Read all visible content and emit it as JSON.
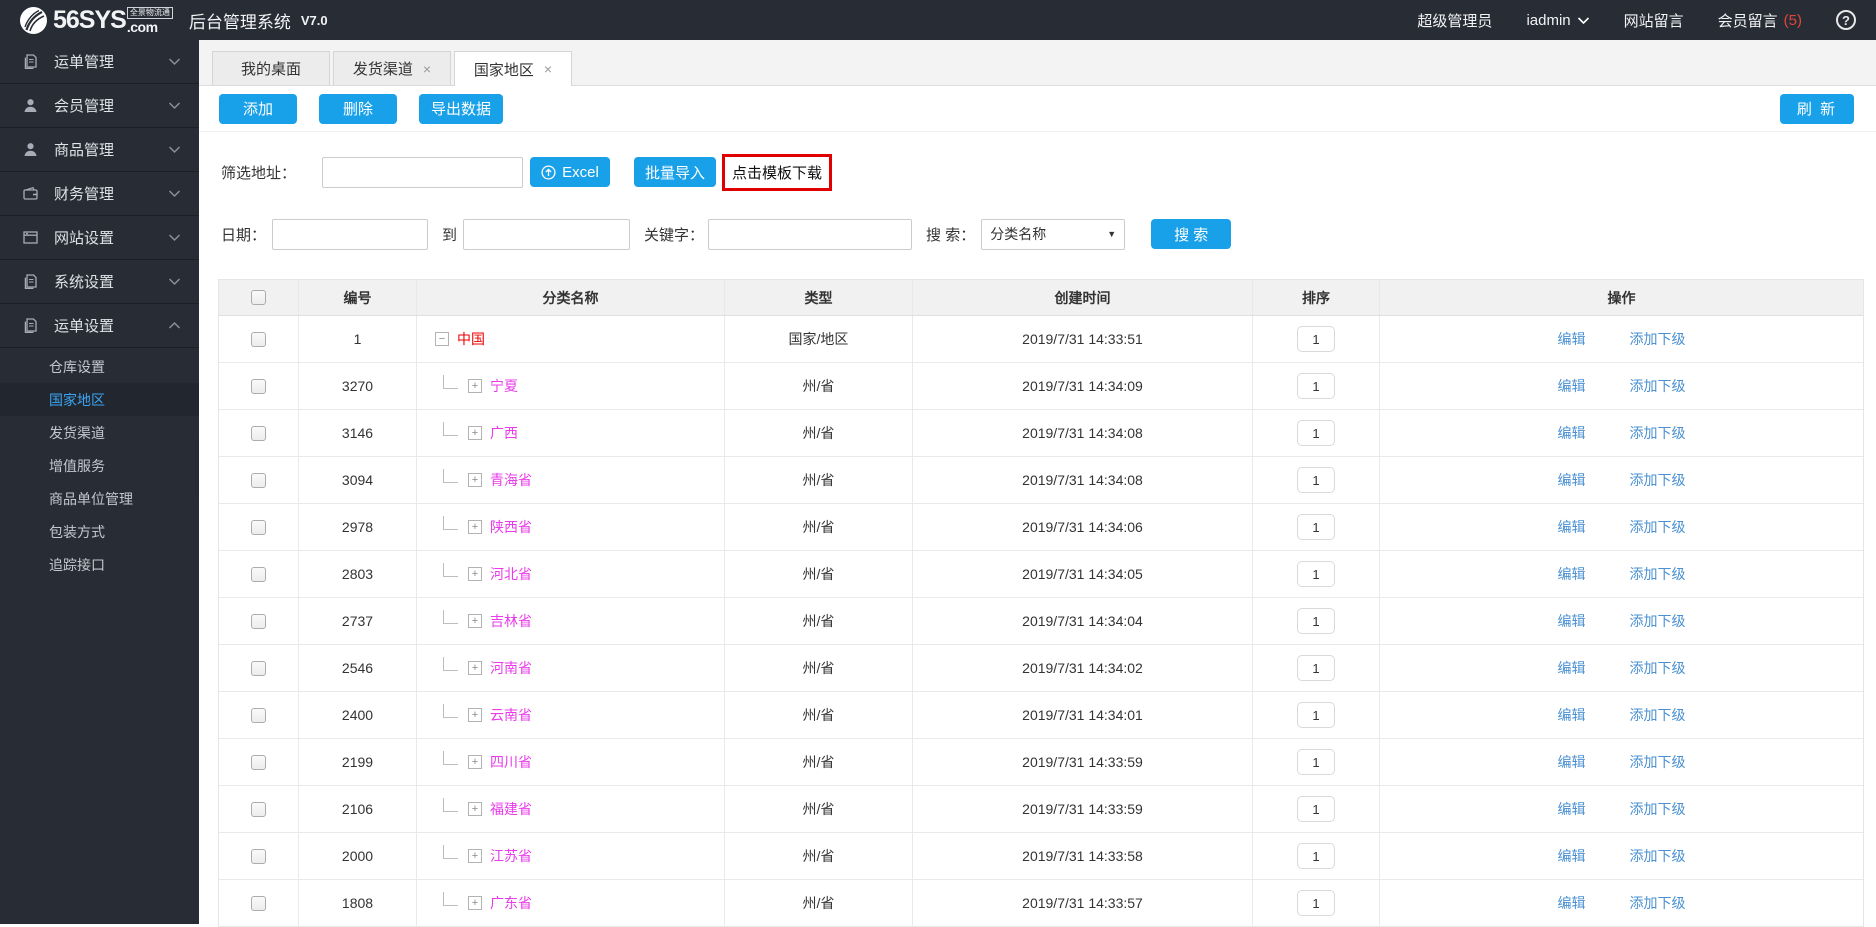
{
  "topbar": {
    "logo_main": "56SYS",
    "logo_small": "全景物流通",
    "logo_com": ".com",
    "app_title": "后台管理系统",
    "version": "V7.0",
    "role": "超级管理员",
    "username": "iadmin",
    "site_messages": "网站留言",
    "member_messages": "会员留言",
    "member_message_count": "(5)",
    "help_glyph": "?"
  },
  "sidebar": {
    "items": [
      {
        "label": "运单管理",
        "icon": "doc-icon",
        "expanded": false
      },
      {
        "label": "会员管理",
        "icon": "user-icon",
        "expanded": false
      },
      {
        "label": "商品管理",
        "icon": "user-icon",
        "expanded": false
      },
      {
        "label": "财务管理",
        "icon": "wallet-icon",
        "expanded": false
      },
      {
        "label": "网站设置",
        "icon": "window-icon",
        "expanded": false
      },
      {
        "label": "系统设置",
        "icon": "doc-icon",
        "expanded": false
      },
      {
        "label": "运单设置",
        "icon": "doc-icon",
        "expanded": true,
        "children": [
          "仓库设置",
          "国家地区",
          "发货渠道",
          "增值服务",
          "商品单位管理",
          "包装方式",
          "追踪接口"
        ],
        "active_child": "国家地区"
      }
    ]
  },
  "tabs": [
    {
      "label": "我的桌面",
      "closable": false,
      "active": false
    },
    {
      "label": "发货渠道",
      "closable": true,
      "active": false
    },
    {
      "label": "国家地区",
      "closable": true,
      "active": true
    }
  ],
  "toolbar": {
    "add": "添加",
    "delete": "删除",
    "export": "导出数据",
    "refresh": "刷 新"
  },
  "filter": {
    "address_label": "筛选地址：",
    "address_value": "",
    "excel_button": "Excel",
    "batch_import": "批量导入",
    "template_download": "点击模板下载",
    "date_label": "日期：",
    "date_from": "",
    "to_label": "到",
    "date_to": "",
    "keyword_label": "关键字：",
    "keyword_value": "",
    "search_label": "搜 索：",
    "search_select": "分类名称",
    "search_button": "搜 索"
  },
  "table": {
    "headers": [
      "编号",
      "分类名称",
      "类型",
      "创建时间",
      "排序",
      "操作"
    ],
    "actions": [
      "编辑",
      "添加下级"
    ],
    "tree_icons": {
      "collapse": "−",
      "expand": "+"
    },
    "rows": [
      {
        "no": "1",
        "name": "中国",
        "root": true,
        "type": "国家/地区",
        "created": "2019/7/31 14:33:51",
        "sort": "1"
      },
      {
        "no": "3270",
        "name": "宁夏",
        "root": false,
        "type": "州/省",
        "created": "2019/7/31 14:34:09",
        "sort": "1"
      },
      {
        "no": "3146",
        "name": "广西",
        "root": false,
        "type": "州/省",
        "created": "2019/7/31 14:34:08",
        "sort": "1"
      },
      {
        "no": "3094",
        "name": "青海省",
        "root": false,
        "type": "州/省",
        "created": "2019/7/31 14:34:08",
        "sort": "1"
      },
      {
        "no": "2978",
        "name": "陕西省",
        "root": false,
        "type": "州/省",
        "created": "2019/7/31 14:34:06",
        "sort": "1"
      },
      {
        "no": "2803",
        "name": "河北省",
        "root": false,
        "type": "州/省",
        "created": "2019/7/31 14:34:05",
        "sort": "1"
      },
      {
        "no": "2737",
        "name": "吉林省",
        "root": false,
        "type": "州/省",
        "created": "2019/7/31 14:34:04",
        "sort": "1"
      },
      {
        "no": "2546",
        "name": "河南省",
        "root": false,
        "type": "州/省",
        "created": "2019/7/31 14:34:02",
        "sort": "1"
      },
      {
        "no": "2400",
        "name": "云南省",
        "root": false,
        "type": "州/省",
        "created": "2019/7/31 14:34:01",
        "sort": "1"
      },
      {
        "no": "2199",
        "name": "四川省",
        "root": false,
        "type": "州/省",
        "created": "2019/7/31 14:33:59",
        "sort": "1"
      },
      {
        "no": "2106",
        "name": "福建省",
        "root": false,
        "type": "州/省",
        "created": "2019/7/31 14:33:59",
        "sort": "1"
      },
      {
        "no": "2000",
        "name": "江苏省",
        "root": false,
        "type": "州/省",
        "created": "2019/7/31 14:33:58",
        "sort": "1"
      },
      {
        "no": "1808",
        "name": "广东省",
        "root": false,
        "type": "州/省",
        "created": "2019/7/31 14:33:57",
        "sort": "1"
      }
    ]
  },
  "colors": {
    "accent": "#18A0E9",
    "magenta": "#E93BE9",
    "root_red": "#F00000",
    "link_blue": "#4A90D2",
    "annotation_red": "#E10000",
    "chrome_dark": "#282C35"
  }
}
